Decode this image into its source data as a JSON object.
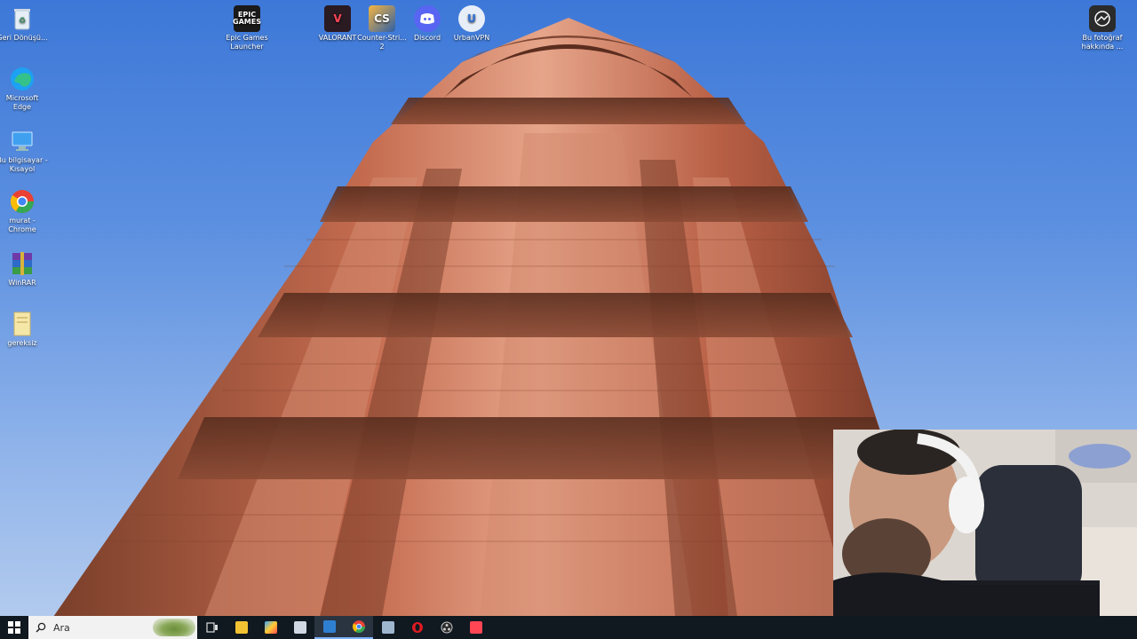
{
  "desktop_icons_left": [
    {
      "id": "recycle-bin",
      "label": "Geri Dönüşü...",
      "icon": "recycle-bin-icon"
    },
    {
      "id": "edge",
      "label": "Microsoft Edge",
      "icon": "edge-icon"
    },
    {
      "id": "this-pc",
      "label": "Bu bilgisayar - Kısayol",
      "icon": "computer-icon"
    },
    {
      "id": "chrome",
      "label": "murat - Chrome",
      "icon": "chrome-icon"
    },
    {
      "id": "winrar",
      "label": "WinRAR",
      "icon": "winrar-icon"
    },
    {
      "id": "gereksiz",
      "label": "gereksiz",
      "icon": "folder-icon"
    }
  ],
  "desktop_icons_top": [
    {
      "id": "epic",
      "label": "Epic Games Launcher",
      "icon": "epic-games-icon",
      "color": "#1a1a1a"
    },
    {
      "id": "valorant",
      "label": "VALORANT",
      "icon": "valorant-icon",
      "color": "#2a1a22"
    },
    {
      "id": "cs",
      "label": "Counter-Stri... 2",
      "icon": "counter-strike-icon",
      "color": "#e09a2a"
    },
    {
      "id": "discord",
      "label": "Discord",
      "icon": "discord-icon",
      "color": "#5865f2"
    },
    {
      "id": "urbanvpn",
      "label": "UrbanVPN",
      "icon": "urbanvpn-icon",
      "color": "#e8eef8"
    }
  ],
  "desktop_icon_right": {
    "label": "Bu fotoğraf hakkında ...",
    "icon": "about-photo-icon"
  },
  "taskbar": {
    "search_placeholder": "Ara",
    "apps": [
      {
        "name": "task-view",
        "color": "#dddddd"
      },
      {
        "name": "file-explorer",
        "color": "#f1c232"
      },
      {
        "name": "photos",
        "color": "#3aa3ff"
      },
      {
        "name": "store",
        "color": "#cfd8e3"
      },
      {
        "name": "mail",
        "color": "#2f7fd1",
        "active": true
      },
      {
        "name": "chrome",
        "color": "#e94235",
        "active": true
      },
      {
        "name": "calculator",
        "color": "#9fb6cf"
      },
      {
        "name": "opera",
        "color": "#e01a22"
      },
      {
        "name": "obs",
        "color": "#cccccc"
      },
      {
        "name": "valorant",
        "color": "#ff4655"
      }
    ]
  },
  "colors": {
    "sky_top": "#3d78d8",
    "taskbar": "#101820"
  }
}
